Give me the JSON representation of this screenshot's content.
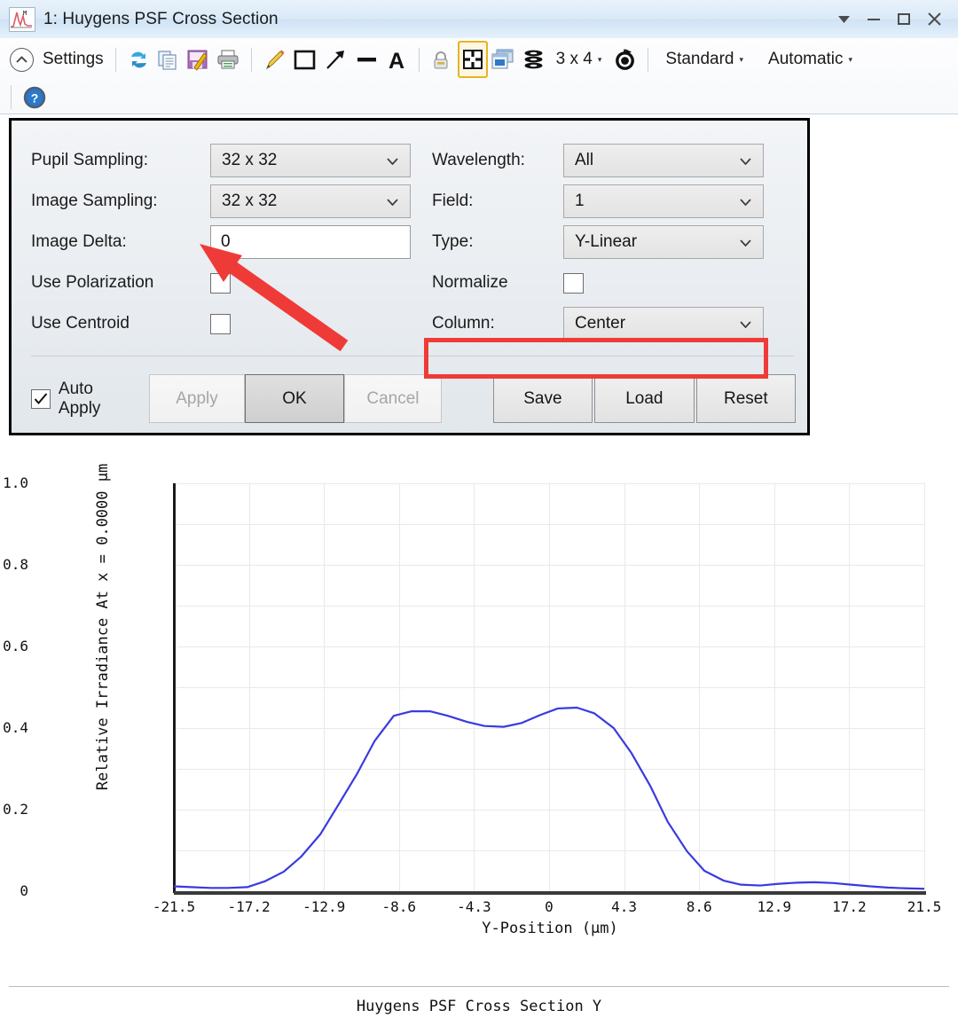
{
  "window": {
    "title": "1: Huygens PSF Cross Section",
    "app_icon": "chart-window-icon",
    "controls": [
      {
        "name": "dropdown-menu",
        "glyph": "▼"
      },
      {
        "name": "minimize",
        "glyph": "–"
      },
      {
        "name": "maximize",
        "glyph": "□"
      },
      {
        "name": "close",
        "glyph": "✕"
      }
    ]
  },
  "toolbar": {
    "settings_label": "Settings",
    "settings_chevron": "⌃",
    "layout_label": "3 x 4",
    "layout_caret": "▾",
    "style_label": "Standard",
    "style_caret": "▾",
    "scale_label": "Automatic",
    "scale_caret": "▾",
    "icons": [
      "refresh-icon",
      "copy-icon",
      "save-as-icon",
      "print-icon",
      "pencil-icon",
      "rectangle-icon",
      "arrow-icon",
      "line-icon",
      "text-icon",
      "lock-icon",
      "grid-layout-icon",
      "window-tile-icon",
      "layers-icon",
      "reset-clock-icon",
      "help-icon"
    ]
  },
  "settings": {
    "left_fields": [
      {
        "label": "Pupil Sampling:",
        "value": "32 x 32",
        "control": "combo"
      },
      {
        "label": "Image Sampling:",
        "value": "32 x 32",
        "control": "combo"
      },
      {
        "label": "Image Delta:",
        "value": "0",
        "control": "text"
      },
      {
        "label": "Use Polarization",
        "value": "",
        "control": "checkbox",
        "checked": false
      },
      {
        "label": "Use Centroid",
        "value": "",
        "control": "checkbox",
        "checked": false
      }
    ],
    "right_fields": [
      {
        "label": "Wavelength:",
        "value": "All",
        "control": "combo"
      },
      {
        "label": "Field:",
        "value": "1",
        "control": "combo"
      },
      {
        "label": "Type:",
        "value": "Y-Linear",
        "control": "combo",
        "highlighted": true
      },
      {
        "label": "Normalize",
        "value": "",
        "control": "checkbox",
        "checked": false
      },
      {
        "label": "Column:",
        "value": "Center",
        "control": "combo"
      }
    ],
    "auto_apply": {
      "label": "Auto Apply",
      "checked": true
    },
    "buttons": [
      {
        "label": "Apply",
        "state": "disabled"
      },
      {
        "label": "OK",
        "state": "default"
      },
      {
        "label": "Cancel",
        "state": "disabled"
      },
      {
        "label": "Save",
        "state": "normal"
      },
      {
        "label": "Load",
        "state": "normal"
      },
      {
        "label": "Reset",
        "state": "normal"
      }
    ]
  },
  "annotations": {
    "highlight_color": "#ef3b37",
    "arrow_color": "#ef3b37",
    "arrow_target": "image-delta-input",
    "highlight_target": "type-combo"
  },
  "caption": "Huygens PSF Cross Section Y",
  "chart_data": {
    "type": "line",
    "title": "",
    "xlabel": "Y-Position (µm)",
    "ylabel": "Relative Irradiance At x = 0.0000 µm",
    "xlim": [
      -21.5,
      21.5
    ],
    "ylim": [
      0,
      1.0
    ],
    "xticks": [
      -21.5,
      -17.2,
      -12.9,
      -8.6,
      -4.3,
      0,
      4.3,
      8.6,
      12.9,
      17.2,
      21.5
    ],
    "xticklabels": [
      "-21.5",
      "-17.2",
      "-12.9",
      "-8.6",
      "-4.3",
      "0",
      "4.3",
      "8.6",
      "12.9",
      "17.2",
      "21.5"
    ],
    "yticks": [
      0,
      0.2,
      0.4,
      0.6,
      0.8,
      1.0
    ],
    "yticklabels": [
      "0",
      "0.2",
      "0.4",
      "0.6",
      "0.8",
      "1.0"
    ],
    "grid": true,
    "legend": "none",
    "series": [
      {
        "name": "Relative Irradiance",
        "color": "#3a3ae0",
        "x": [
          -21.5,
          -20.5,
          -19.4,
          -18.4,
          -17.3,
          -16.3,
          -15.2,
          -14.2,
          -13.1,
          -12.1,
          -11.0,
          -10.0,
          -8.9,
          -7.9,
          -6.8,
          -5.8,
          -4.7,
          -3.7,
          -2.6,
          -1.6,
          -0.5,
          0.5,
          1.6,
          2.6,
          3.7,
          4.7,
          5.8,
          6.8,
          7.9,
          8.9,
          10.0,
          11.0,
          12.1,
          13.1,
          14.2,
          15.2,
          16.3,
          17.3,
          18.4,
          19.4,
          20.5,
          21.5
        ],
        "y": [
          0.012,
          0.01,
          0.008,
          0.008,
          0.01,
          0.024,
          0.048,
          0.085,
          0.14,
          0.21,
          0.288,
          0.368,
          0.43,
          0.441,
          0.441,
          0.43,
          0.415,
          0.405,
          0.403,
          0.412,
          0.432,
          0.448,
          0.45,
          0.436,
          0.4,
          0.34,
          0.258,
          0.17,
          0.098,
          0.05,
          0.026,
          0.016,
          0.014,
          0.018,
          0.021,
          0.022,
          0.02,
          0.016,
          0.012,
          0.009,
          0.007,
          0.006
        ]
      }
    ]
  }
}
